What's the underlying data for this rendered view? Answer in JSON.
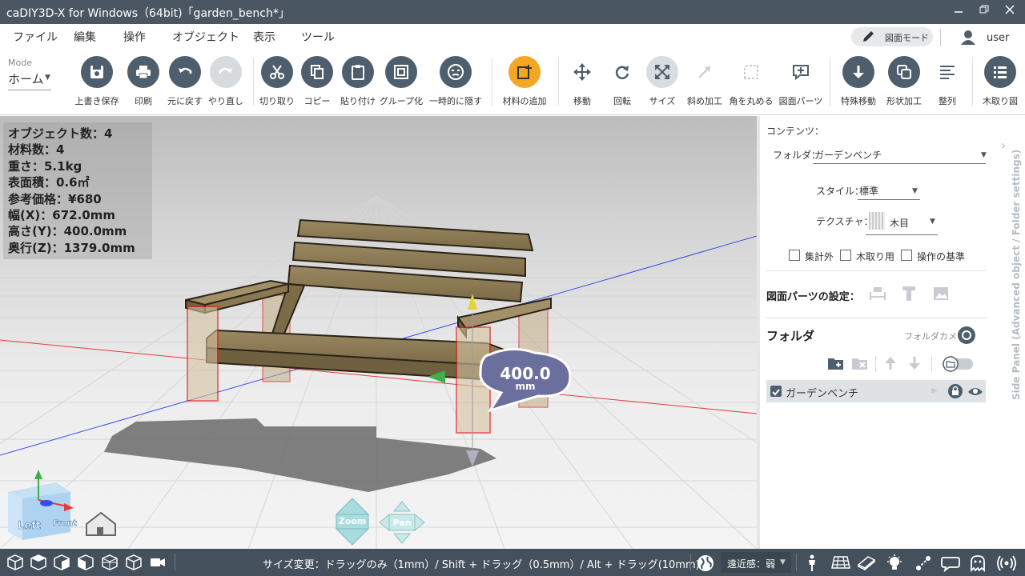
{
  "window": {
    "title": "caDIY3D-X for Windows（64bit)「garden_bench*」",
    "controls": [
      "minimize",
      "restore",
      "close"
    ]
  },
  "menu": {
    "items": [
      "ファイル",
      "編集",
      "操作",
      "オブジェクト",
      "表示",
      "ツール"
    ],
    "mode_button": "図面モード",
    "user": "user"
  },
  "toolbar": {
    "mode_caption": "Mode",
    "mode_value": "ホーム",
    "tools": [
      {
        "label": "上書き保存",
        "icon": "save-icon"
      },
      {
        "label": "印刷",
        "icon": "print-icon"
      },
      {
        "label": "元に戻す",
        "icon": "undo-icon"
      },
      {
        "label": "やり直し",
        "icon": "redo-icon"
      },
      {
        "label": "切り取り",
        "icon": "scissors-icon"
      },
      {
        "label": "コピー",
        "icon": "copy-icon"
      },
      {
        "label": "貼り付け",
        "icon": "paste-icon"
      },
      {
        "label": "グループ化",
        "icon": "group-icon"
      },
      {
        "label": "一時的に隠す",
        "icon": "hide-face-icon"
      },
      {
        "label": "材料の追加",
        "icon": "add-material-icon"
      },
      {
        "label": "移動",
        "icon": "move-icon"
      },
      {
        "label": "回転",
        "icon": "rotate-icon"
      },
      {
        "label": "サイズ",
        "icon": "resize-icon"
      },
      {
        "label": "斜め加工",
        "icon": "diagonal-cut-icon"
      },
      {
        "label": "角を丸める",
        "icon": "round-corner-icon"
      },
      {
        "label": "図面パーツ",
        "icon": "drawing-parts-icon"
      },
      {
        "label": "特殊移動",
        "icon": "special-move-icon"
      },
      {
        "label": "形状加工",
        "icon": "shape-process-icon"
      },
      {
        "label": "整列",
        "icon": "align-icon"
      },
      {
        "label": "木取り図",
        "icon": "cut-list-icon"
      }
    ]
  },
  "viewport": {
    "info": [
      "オブジェクト数：4",
      "材料数：4",
      "重さ：5.1kg",
      "表面積：0.6㎡",
      "参考価格：¥680",
      "幅(X)：672.0mm",
      "高さ(Y)：400.0mm",
      "奥行(Z)：1379.0mm"
    ],
    "dimension_value": "400.0",
    "dimension_unit": "mm",
    "view_cube": {
      "left": "Left",
      "front": "Front"
    },
    "zoom_label": "Zoom",
    "pan_label": "Pan",
    "colors": {
      "x_axis": "#e33b3b",
      "z_axis": "#3b4de3",
      "selection": "#e02020",
      "wood": "#8b7a55"
    }
  },
  "side_panel": {
    "contents_label": "コンテンツ：",
    "folder_label": "フォルダ：",
    "folder_value": "ガーデンベンチ",
    "style_label": "スタイル：",
    "style_value": "標準",
    "texture_label": "テクスチャ：",
    "texture_value": "木目",
    "checkboxes": [
      "集計外",
      "木取り用",
      "操作の基準"
    ],
    "parts_settings": "図面パーツの設定：",
    "folder_heading": "フォルダ",
    "folder_camera": "フォルダカメラ",
    "folder_item": "ガーデンベンチ",
    "vertical_title": "Side Panel (Advanced object / Folder settings)"
  },
  "statusbar": {
    "hint": "サイズ変更：ドラッグのみ（1mm）/ Shift + ドラッグ（0.5mm）/ Alt + ドラッグ(10mm)",
    "perspective": "遠近感：弱"
  }
}
